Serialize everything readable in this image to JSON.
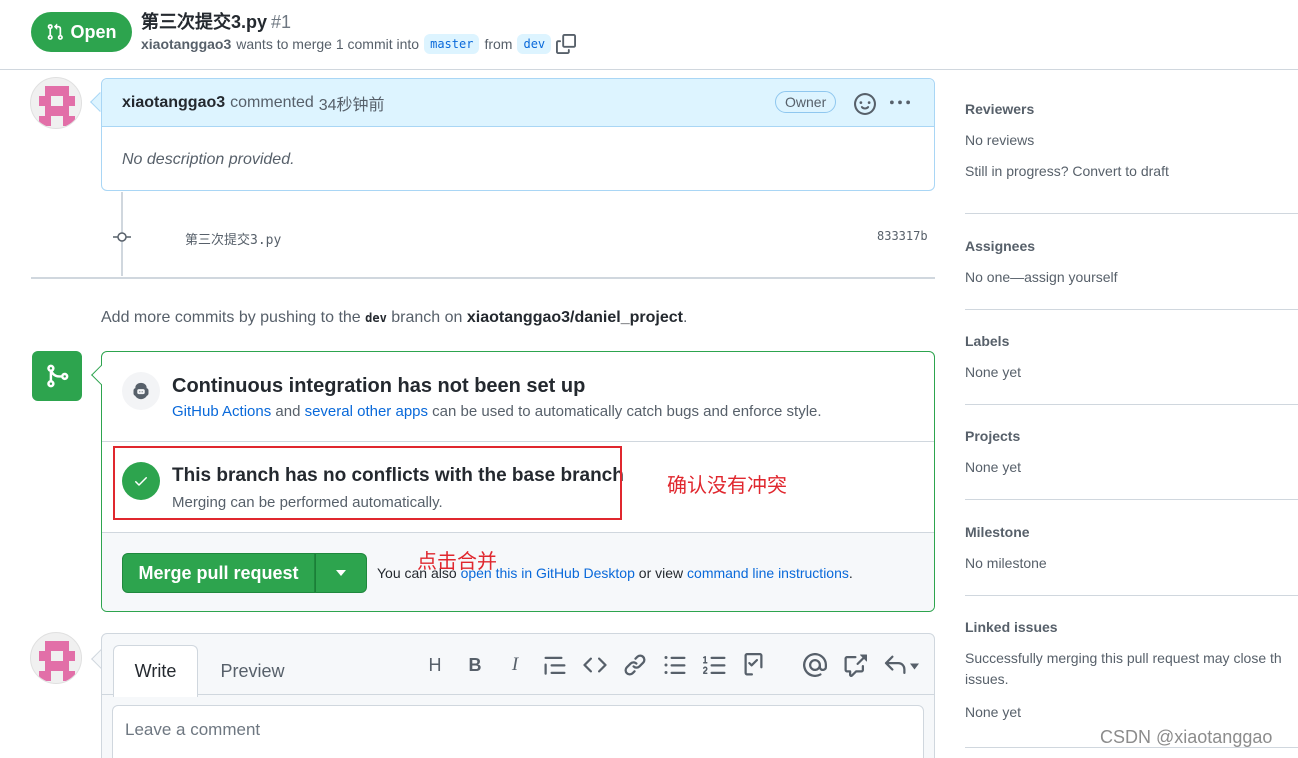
{
  "header": {
    "state": "Open",
    "title": "第三次提交3.py",
    "number": "#1",
    "author": "xiaotanggao3",
    "merge_text": "wants to merge 1 commit into",
    "base_branch": "master",
    "from_text": "from",
    "head_branch": "dev"
  },
  "comment": {
    "author": "xiaotanggao3",
    "action": "commented",
    "time": "34秒钟前",
    "badge": "Owner",
    "body": "No description provided."
  },
  "commit": {
    "message": "第三次提交3.py",
    "sha": "833317b"
  },
  "push_hint": {
    "prefix": "Add more commits by pushing to the",
    "branch": "dev",
    "middle": "branch on",
    "repo": "xiaotanggao3/daniel_project",
    "suffix": "."
  },
  "merge": {
    "ci_title": "Continuous integration has not been set up",
    "ci_link1": "GitHub Actions",
    "ci_and": "and",
    "ci_link2": "several other apps",
    "ci_rest": "can be used to automatically catch bugs and enforce style.",
    "nc_title": "This branch has no conflicts with the base branch",
    "nc_desc": "Merging can be performed automatically.",
    "button": "Merge pull request",
    "alt_prefix": "You can also",
    "alt_link1": "open this in GitHub Desktop",
    "alt_mid": "or view",
    "alt_link2": "command line instructions",
    "alt_suffix": "."
  },
  "annotations": {
    "note1": "确认没有冲突",
    "note2": "点击合并"
  },
  "editor": {
    "tab_write": "Write",
    "tab_preview": "Preview",
    "placeholder": "Leave a comment",
    "tool_heading": "H",
    "tool_bold": "B",
    "tool_italic": "I"
  },
  "sidebar": {
    "reviewers_title": "Reviewers",
    "reviewers_value": "No reviews",
    "draft_hint": "Still in progress? Convert to draft",
    "assignees_title": "Assignees",
    "assignees_value": "No one—assign yourself",
    "labels_title": "Labels",
    "labels_value": "None yet",
    "projects_title": "Projects",
    "projects_value": "None yet",
    "milestone_title": "Milestone",
    "milestone_value": "No milestone",
    "linked_title": "Linked issues",
    "linked_desc_1": "Successfully merging this pull request may close th",
    "linked_desc_2": "issues.",
    "linked_value": "None yet"
  },
  "watermark": "CSDN @xiaotanggao",
  "colors": {
    "green": "#2da44e",
    "blue_link": "#0969da",
    "annotation_red": "#e0272e",
    "comment_header_bg": "#ddf4ff"
  }
}
